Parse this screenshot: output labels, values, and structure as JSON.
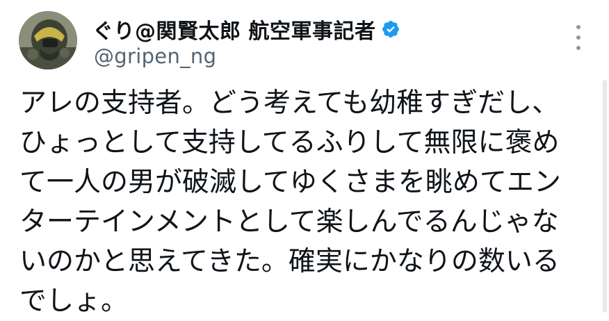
{
  "tweet": {
    "author": {
      "display_name": "ぐり@関賢太郎 航空軍事記者",
      "handle": "@gripen_ng",
      "verified_icon": "verified-badge-icon",
      "avatar_icon": "pilot-helmet-avatar"
    },
    "body_lines": [
      "アレの支持者。どう考えても幼稚すぎだし、",
      "ひょっとして支持してるふりして無限に褒め",
      "て一人の男が破滅してゆくさまを眺めてエン",
      "ターテインメントとして楽しんでるんじゃな",
      "いのかと思えてきた。確実にかなりの数いる",
      "でしょ。"
    ],
    "more_icon": "more-options-icon"
  },
  "colors": {
    "text": "#0f1419",
    "secondary": "#536471",
    "verified": "#1d9bf0"
  }
}
